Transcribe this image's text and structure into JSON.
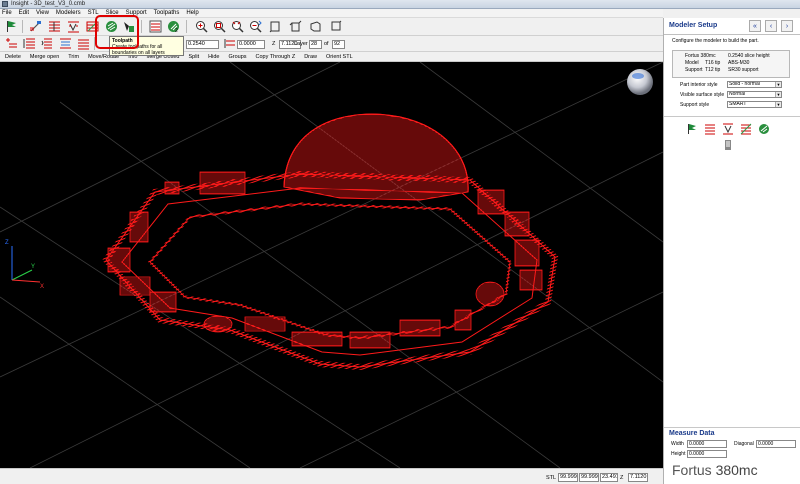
{
  "window": {
    "title": "Insight - 3D_test_V3_0.cmb"
  },
  "menu": [
    "File",
    "Edit",
    "View",
    "Modelers",
    "STL",
    "Slice",
    "Support",
    "Toolpaths",
    "Help"
  ],
  "tooltip": {
    "title": "Toolpath",
    "text": "Create toolpaths for all boundaries on all layers"
  },
  "toolbar": {
    "slice_height": "0.2540",
    "offset": "0.0000",
    "z_label": "Z",
    "z_value": "7.1120",
    "layer_label": "Layer",
    "layer_value": "28",
    "of_label": "of",
    "layer_total": "92"
  },
  "commands": [
    "Delete",
    "Merge open",
    "Trim",
    "Move/Rotate",
    "Info",
    "Merge closed",
    "Split",
    "Hide",
    "Groups",
    "Copy Through Z",
    "Draw",
    "Orient STL"
  ],
  "viewport": {
    "axis_labels": {
      "y": "Y",
      "z": "Z",
      "x": "X"
    },
    "model_color": "#ff1a1a",
    "background": "#000000"
  },
  "statusbar": {
    "mode": "STL",
    "x_value": "99.9999",
    "y_value": "99.9999",
    "w_value": "23.4918",
    "z_label": "Z",
    "z_value": "7.1120"
  },
  "panel": {
    "title": "Modeler Setup",
    "description": "Configure the modeler to build the part.",
    "info": {
      "modeler": "Fortus 380mc",
      "slice_height": "0.2540 slice height",
      "model_label": "Model",
      "model_tip": "T16 tip",
      "model_material": "ABS-M30",
      "support_label": "Support",
      "support_tip": "T12 tip",
      "support_material": "SR30 support"
    },
    "settings": [
      {
        "label": "Part interior style",
        "value": "Solid - normal"
      },
      {
        "label": "Visible surface style",
        "value": "Normal"
      },
      {
        "label": "Support style",
        "value": "SMART"
      }
    ]
  },
  "measure": {
    "title": "Measure Data",
    "width_label": "Width",
    "width_value": "0.0000",
    "diagonal_label": "Diagonal",
    "diagonal_value": "0.0000",
    "height_label": "Height",
    "height_value": "0.0000"
  },
  "brand": {
    "name": "Fortus",
    "model": "380mc"
  }
}
